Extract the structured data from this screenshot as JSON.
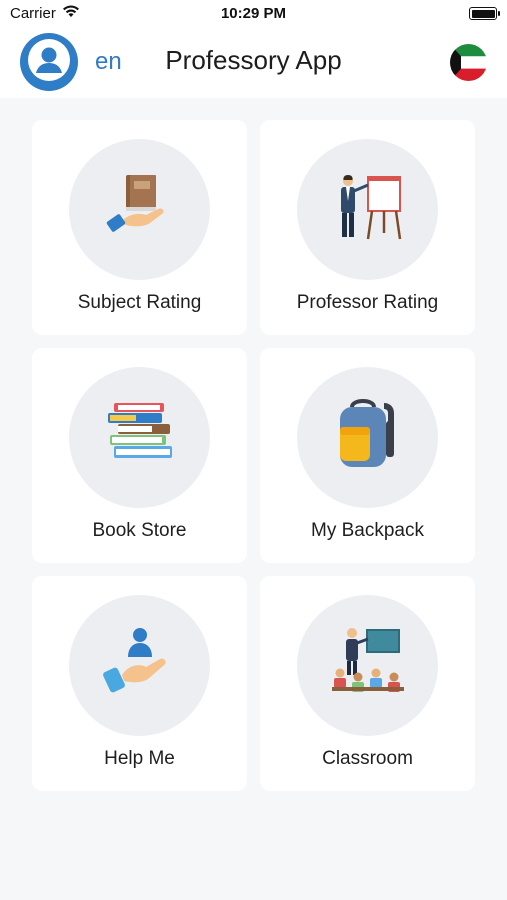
{
  "status_bar": {
    "carrier": "Carrier",
    "time": "10:29 PM"
  },
  "header": {
    "language": "en",
    "title": "Professory App",
    "accent_color": "#2f7cc7"
  },
  "menu": [
    {
      "label": "Subject Rating",
      "icon": "book-in-hand-icon"
    },
    {
      "label": "Professor Rating",
      "icon": "professor-presentation-icon"
    },
    {
      "label": "Book Store",
      "icon": "book-stack-icon"
    },
    {
      "label": "My Backpack",
      "icon": "backpack-icon"
    },
    {
      "label": "Help Me",
      "icon": "helping-hand-icon"
    },
    {
      "label": "Classroom",
      "icon": "classroom-icon"
    }
  ]
}
